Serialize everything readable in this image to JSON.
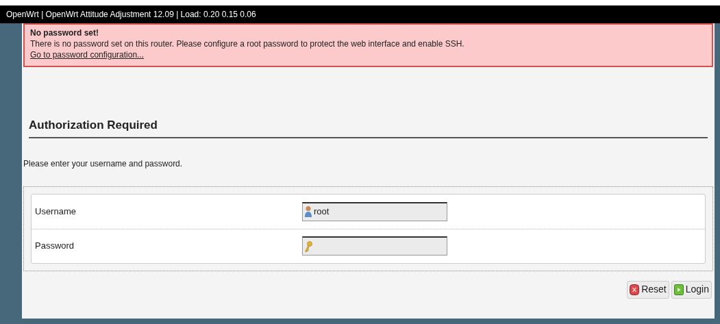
{
  "header": {
    "title": "OpenWrt | OpenWrt Attitude Adjustment 12.09 | Load: 0.20 0.15 0.06"
  },
  "alert": {
    "title": "No password set!",
    "message": "There is no password set on this router. Please configure a root password to protect the web interface and enable SSH.",
    "link": "Go to password configuration..."
  },
  "heading": "Authorization Required",
  "intro": "Please enter your username and password.",
  "fields": [
    {
      "kind": "user",
      "label": "Username",
      "value": "root"
    },
    {
      "kind": "password",
      "label": "Password"
    }
  ],
  "buttons": [
    {
      "kind": "reset",
      "label": "Reset"
    },
    {
      "kind": "login",
      "label": "Login"
    }
  ]
}
